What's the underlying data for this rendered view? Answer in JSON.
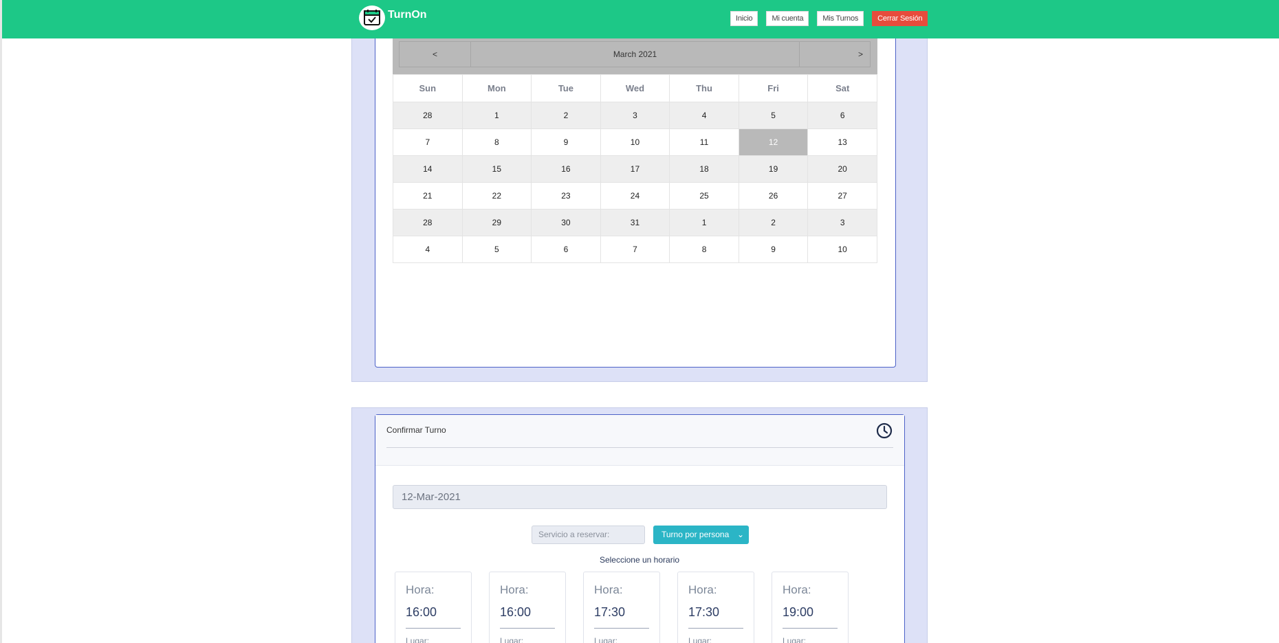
{
  "navbar": {
    "brand": "TurnOn",
    "logo_icon": "calendar-check-icon",
    "buttons": [
      {
        "label": "Inicio"
      },
      {
        "label": "Mi cuenta"
      },
      {
        "label": "Mis Turnos"
      },
      {
        "label": "Cerrar Sesión"
      }
    ],
    "colors": {
      "bar": "#1dc887",
      "logout": "#e74c3c"
    }
  },
  "calendar": {
    "prev_label": "<",
    "next_label": ">",
    "month_title": "March 2021",
    "weekdays": [
      "Sun",
      "Mon",
      "Tue",
      "Wed",
      "Thu",
      "Fri",
      "Sat"
    ],
    "weeks": [
      [
        "28",
        "1",
        "2",
        "3",
        "4",
        "5",
        "6"
      ],
      [
        "7",
        "8",
        "9",
        "10",
        "11",
        "12",
        "13"
      ],
      [
        "14",
        "15",
        "16",
        "17",
        "18",
        "19",
        "20"
      ],
      [
        "21",
        "22",
        "23",
        "24",
        "25",
        "26",
        "27"
      ],
      [
        "28",
        "29",
        "30",
        "31",
        "1",
        "2",
        "3"
      ],
      [
        "4",
        "5",
        "6",
        "7",
        "8",
        "9",
        "10"
      ]
    ],
    "selected_day": "12"
  },
  "confirm": {
    "title": "Confirmar Turno",
    "icon": "clock-icon",
    "date_value": "12-Mar-2021",
    "service_placeholder": "Servicio a reservar:",
    "service_selected": "Turno por persona",
    "hint": "Seleccione un horario",
    "slots": [
      {
        "label": "Hora:",
        "time": "16:00",
        "sub": "Lugar:"
      },
      {
        "label": "Hora:",
        "time": "16:00",
        "sub": "Lugar:"
      },
      {
        "label": "Hora:",
        "time": "17:30",
        "sub": "Lugar:"
      },
      {
        "label": "Hora:",
        "time": "17:30",
        "sub": "Lugar:"
      },
      {
        "label": "Hora:",
        "time": "19:00",
        "sub": "Lugar:"
      }
    ]
  }
}
